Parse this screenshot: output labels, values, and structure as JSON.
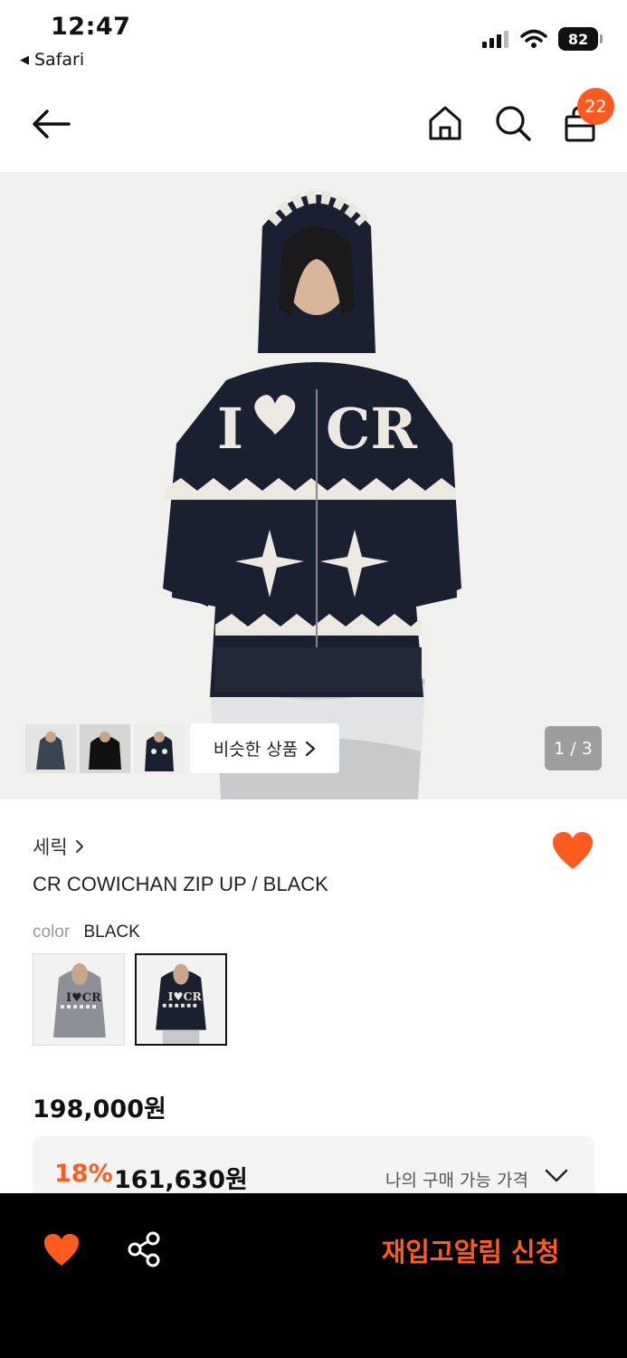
{
  "status_bar": {
    "time": "12:47",
    "back_app": "Safari",
    "battery": "82"
  },
  "nav": {
    "cart_count": "22"
  },
  "gallery": {
    "similar_label": "비슷한 상품",
    "page_indicator": "1 / 3"
  },
  "product": {
    "brand": "세릭",
    "name": "CR COWICHAN ZIP UP / BLACK",
    "color_label": "color",
    "color_value": "BLACK",
    "price": "198,000원",
    "discount_pct": "18%",
    "discount_price": "161,630원",
    "my_price_label": "나의 구매 가능 가격"
  },
  "bottom": {
    "restock_label": "재입고알림 신청"
  },
  "colors": {
    "accent": "#ff5a1f",
    "bar": "#000000"
  },
  "icons": [
    "back-arrow-icon",
    "home-icon",
    "search-icon",
    "shopping-bag-icon",
    "heart-icon",
    "share-icon",
    "chevron-down-icon",
    "chevron-right-icon"
  ]
}
